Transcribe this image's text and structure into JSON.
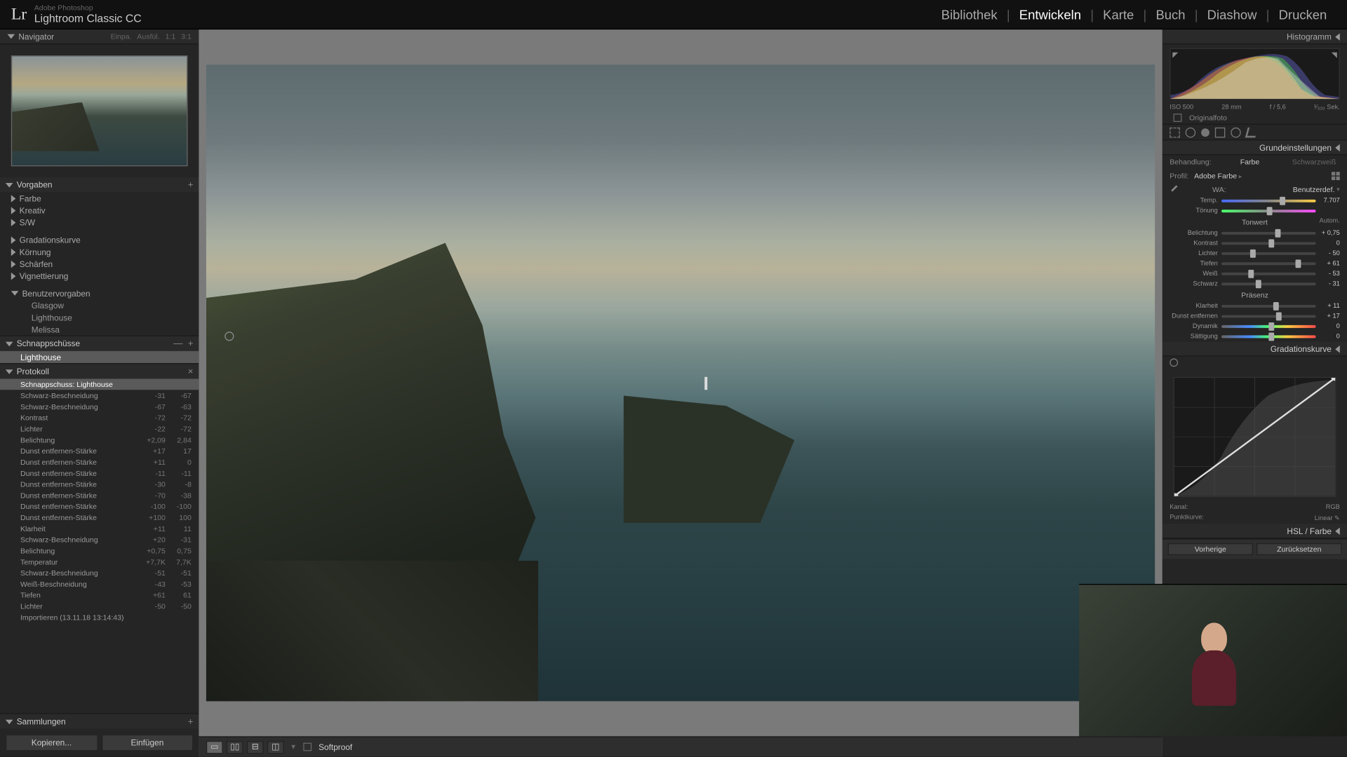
{
  "app": {
    "tagline": "Adobe Photoshop",
    "name": "Lightroom Classic CC"
  },
  "modules": [
    "Bibliothek",
    "Entwickeln",
    "Karte",
    "Buch",
    "Diashow",
    "Drucken"
  ],
  "activeModule": 1,
  "navigator": {
    "title": "Navigator",
    "opts": [
      "Einpa.",
      "Ausfül.",
      "1:1",
      "3:1"
    ]
  },
  "presets": {
    "title": "Vorgaben",
    "groups": [
      "Farbe",
      "Kreativ",
      "S/W"
    ],
    "groups2": [
      "Gradationskurve",
      "Körnung",
      "Schärfen",
      "Vignettierung"
    ],
    "userTitle": "Benutzervorgaben",
    "userItems": [
      "Glasgow",
      "Lighthouse",
      "Melissa"
    ]
  },
  "snapshots": {
    "title": "Schnappschüsse",
    "item": "Lighthouse"
  },
  "history": {
    "title": "Protokoll",
    "rows": [
      {
        "l": "Schnappschuss: Lighthouse",
        "a": "",
        "b": "",
        "sel": true
      },
      {
        "l": "Schwarz-Beschneidung",
        "a": "-31",
        "b": "-67"
      },
      {
        "l": "Schwarz-Beschneidung",
        "a": "-67",
        "b": "-63"
      },
      {
        "l": "Kontrast",
        "a": "-72",
        "b": "-72"
      },
      {
        "l": "Lichter",
        "a": "-22",
        "b": "-72"
      },
      {
        "l": "Belichtung",
        "a": "+2,09",
        "b": "2,84"
      },
      {
        "l": "Dunst entfernen-Stärke",
        "a": "+17",
        "b": "17"
      },
      {
        "l": "Dunst entfernen-Stärke",
        "a": "+11",
        "b": "0"
      },
      {
        "l": "Dunst entfernen-Stärke",
        "a": "-11",
        "b": "-11"
      },
      {
        "l": "Dunst entfernen-Stärke",
        "a": "-30",
        "b": "-8"
      },
      {
        "l": "Dunst entfernen-Stärke",
        "a": "-70",
        "b": "-38"
      },
      {
        "l": "Dunst entfernen-Stärke",
        "a": "-100",
        "b": "-100"
      },
      {
        "l": "Dunst entfernen-Stärke",
        "a": "+100",
        "b": "100"
      },
      {
        "l": "Klarheit",
        "a": "+11",
        "b": "11"
      },
      {
        "l": "Schwarz-Beschneidung",
        "a": "+20",
        "b": "-31"
      },
      {
        "l": "Belichtung",
        "a": "+0,75",
        "b": "0,75"
      },
      {
        "l": "Temperatur",
        "a": "+7,7K",
        "b": "7,7K"
      },
      {
        "l": "Schwarz-Beschneidung",
        "a": "-51",
        "b": "-51"
      },
      {
        "l": "Weiß-Beschneidung",
        "a": "-43",
        "b": "-53"
      },
      {
        "l": "Tiefen",
        "a": "+61",
        "b": "61"
      },
      {
        "l": "Lichter",
        "a": "-50",
        "b": "-50"
      },
      {
        "l": "Importieren (13.11.18 13:14:43)",
        "a": "",
        "b": ""
      }
    ]
  },
  "collections": {
    "title": "Sammlungen"
  },
  "leftBtns": {
    "copy": "Kopieren...",
    "paste": "Einfügen"
  },
  "toolbar": {
    "softproof": "Softproof"
  },
  "rightBtns": {
    "prev": "Vorherige",
    "reset": "Zurücksetzen"
  },
  "histogram": {
    "title": "Histogramm",
    "info": [
      "ISO 500",
      "28 mm",
      "f / 5,6",
      "¹⁄₃₂₀ Sek."
    ],
    "orig": "Originalfoto"
  },
  "basic": {
    "title": "Grundeinstellungen",
    "treatLabel": "Behandlung:",
    "treatColor": "Farbe",
    "treatBW": "Schwarzweiß",
    "profileLabel": "Profil:",
    "profileVal": "Adobe Farbe",
    "wbLabel": "WA:",
    "wbVal": "Benutzerdef.",
    "sliders1": [
      {
        "l": "Temp.",
        "v": "7.707",
        "p": 62,
        "t": "temp"
      },
      {
        "l": "Tönung",
        "v": "",
        "p": 48,
        "t": "tint"
      }
    ],
    "toneTitle": "Tonwert",
    "autoLabel": "Autom.",
    "sliders2": [
      {
        "l": "Belichtung",
        "v": "+ 0,75",
        "p": 57
      },
      {
        "l": "Kontrast",
        "v": "0",
        "p": 50
      },
      {
        "l": "Lichter",
        "v": "- 50",
        "p": 30
      },
      {
        "l": "Tiefen",
        "v": "+ 61",
        "p": 78
      },
      {
        "l": "Weiß",
        "v": "- 53",
        "p": 28
      },
      {
        "l": "Schwarz",
        "v": "- 31",
        "p": 36
      }
    ],
    "presTitle": "Präsenz",
    "sliders3": [
      {
        "l": "Klarheit",
        "v": "+ 11",
        "p": 55
      },
      {
        "l": "Dunst entfernen",
        "v": "+ 17",
        "p": 58
      },
      {
        "l": "Dynamik",
        "v": "0",
        "p": 50,
        "t": "vib"
      },
      {
        "l": "Sättigung",
        "v": "0",
        "p": 50,
        "t": "vib"
      }
    ]
  },
  "tonecurve": {
    "title": "Gradationskurve",
    "channel": "Kanal:",
    "channelVal": "RGB",
    "pointLabel": "Punktkurve:",
    "pointVal": "Linear"
  },
  "hsl": {
    "title": "HSL / Farbe"
  }
}
